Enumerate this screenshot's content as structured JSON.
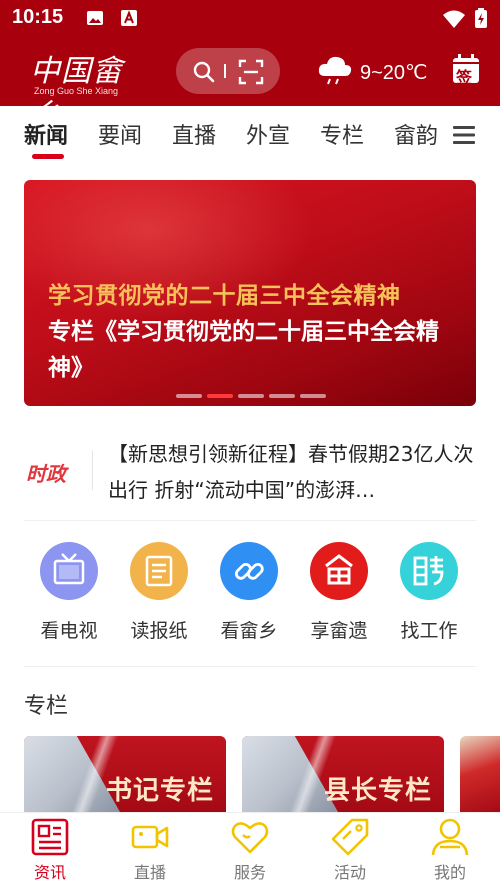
{
  "status_bar": {
    "time": "10:15"
  },
  "header": {
    "logo_text": "中国畲乡",
    "logo_subtitle": "Zong Guo She Xiang",
    "search_icon": "search-icon",
    "scan_icon": "scan-icon",
    "weather_icon": "cloud-rain-icon",
    "weather": "9~20℃",
    "signin_label": "签"
  },
  "tabs": [
    {
      "label": "新闻",
      "active": true
    },
    {
      "label": "要闻"
    },
    {
      "label": "直播"
    },
    {
      "label": "外宣"
    },
    {
      "label": "专栏"
    },
    {
      "label": "畲韵"
    }
  ],
  "banner": {
    "gold_heading": "学习贯彻党的二十届三中全会精神",
    "title": "专栏《学习贯彻党的二十届三中全会精神》",
    "slide_count": 5,
    "active_slide": 2
  },
  "ticker": {
    "tag": "时政",
    "text": "【新思想引领新征程】春节假期23亿人次出行 折射“流动中国”的澎湃…"
  },
  "services": [
    {
      "label": "看电视",
      "icon": "tv-icon",
      "color": "#8c95f0"
    },
    {
      "label": "读报纸",
      "icon": "newspaper-icon",
      "color": "#f2b34a"
    },
    {
      "label": "看畲乡",
      "icon": "link-icon",
      "color": "#2f8ff2"
    },
    {
      "label": "享畲遗",
      "icon": "heritage-icon",
      "color": "#e21b1b"
    },
    {
      "label": "找工作",
      "icon": "recruit-icon",
      "color": "#35d3d9"
    }
  ],
  "columns": {
    "title": "专栏",
    "cards": [
      {
        "label": "书记专栏"
      },
      {
        "label": "县长专栏"
      },
      {
        "label": ""
      }
    ]
  },
  "bottom_nav": [
    {
      "label": "资讯",
      "icon": "news-icon",
      "active": true
    },
    {
      "label": "直播",
      "icon": "video-camera-icon"
    },
    {
      "label": "服务",
      "icon": "heart-icon"
    },
    {
      "label": "活动",
      "icon": "tag-icon"
    },
    {
      "label": "我的",
      "icon": "user-icon"
    }
  ],
  "colors": {
    "brand": "#a8000d",
    "accent": "#d6001c",
    "nav_inactive": "#f2c400"
  }
}
